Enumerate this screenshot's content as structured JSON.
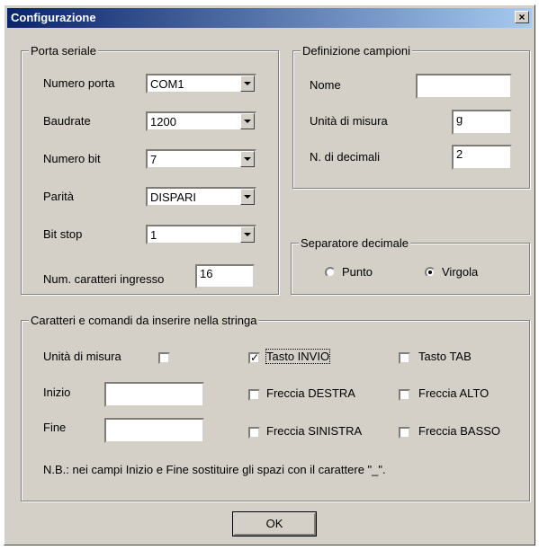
{
  "window": {
    "title": "Configurazione",
    "close_symbol": "×"
  },
  "porta_seriale": {
    "legend": "Porta seriale",
    "numero_porta": {
      "label": "Numero porta",
      "value": "COM1"
    },
    "baudrate": {
      "label": "Baudrate",
      "value": "1200"
    },
    "numero_bit": {
      "label": "Numero bit",
      "value": "7"
    },
    "parita": {
      "label": "Parità",
      "value": "DISPARI"
    },
    "bit_stop": {
      "label": "Bit stop",
      "value": "1"
    },
    "num_caratteri": {
      "label": "Num. caratteri ingresso",
      "value": "16"
    }
  },
  "definizione": {
    "legend": "Definizione campioni",
    "nome": {
      "label": "Nome",
      "value": ""
    },
    "unita": {
      "label": "Unità di misura",
      "value": "g"
    },
    "decimali": {
      "label": "N. di decimali",
      "value": "2"
    }
  },
  "separatore": {
    "legend": "Separatore decimale",
    "punto": {
      "label": "Punto",
      "selected": false
    },
    "virgola": {
      "label": "Virgola",
      "selected": true
    }
  },
  "caratteri": {
    "legend": "Caratteri e comandi da inserire nella stringa",
    "unita_misura": {
      "label": "Unità di misura",
      "checked": false
    },
    "tasto_invio": {
      "label": "Tasto INVIO",
      "checked": true
    },
    "tasto_tab": {
      "label": "Tasto TAB",
      "checked": false
    },
    "inizio": {
      "label": "Inizio",
      "value": ""
    },
    "fine": {
      "label": "Fine",
      "value": ""
    },
    "freccia_destra": {
      "label": "Freccia DESTRA",
      "checked": false
    },
    "freccia_alto": {
      "label": "Freccia ALTO",
      "checked": false
    },
    "freccia_sinistra": {
      "label": "Freccia SINISTRA",
      "checked": false
    },
    "freccia_basso": {
      "label": "Freccia BASSO",
      "checked": false
    },
    "nota": "N.B.: nei campi Inizio e Fine sostituire gli spazi con il carattere \"_\"."
  },
  "ok_label": "OK",
  "check_mark": "✓"
}
